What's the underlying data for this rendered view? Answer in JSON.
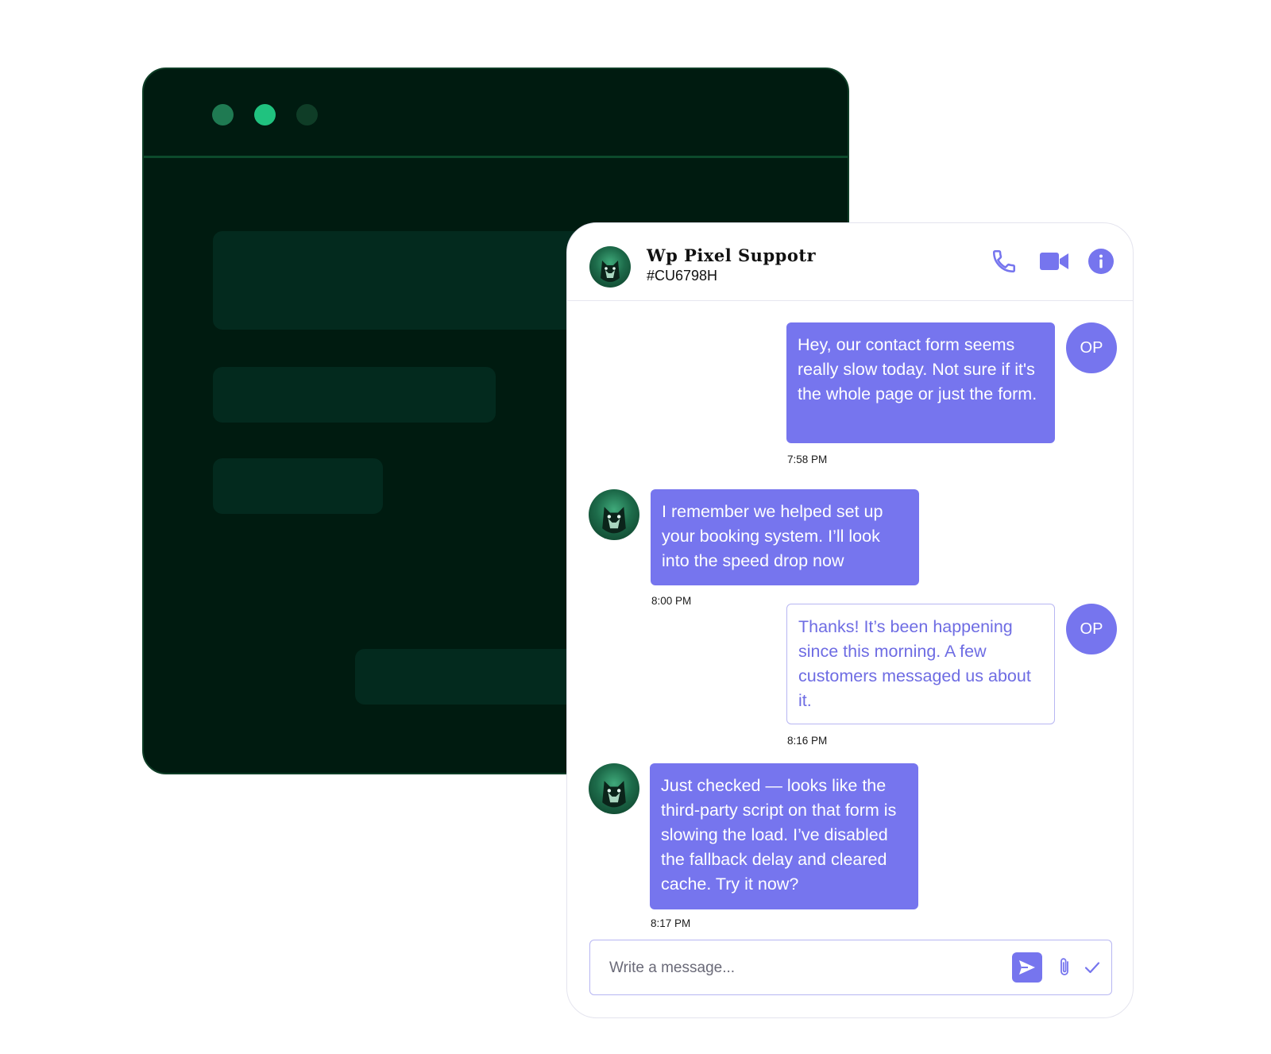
{
  "header": {
    "agent_name": "Wp Pixel Suppotr",
    "ticket_id": "#CU6798H",
    "icons": [
      "phone-icon",
      "video-icon",
      "info-icon"
    ]
  },
  "messages": [
    {
      "sender": "customer",
      "avatar_label": "OP",
      "text": "Hey, our contact form seems really slow today. Not sure if it's the whole page or just the form.",
      "time": "7:58 PM",
      "style": "filled"
    },
    {
      "sender": "agent",
      "text": "I remember we helped set up your booking system. I’ll look into the speed drop now",
      "time": "8:00 PM",
      "style": "filled"
    },
    {
      "sender": "customer",
      "avatar_label": "OP",
      "text": "Thanks! It’s been happening since this morning. A few customers messaged us about it.",
      "time": "8:16 PM",
      "style": "outline"
    },
    {
      "sender": "agent",
      "text": "Just checked — looks like the third-party script on that form is slowing the load. I’ve disabled the fallback delay and cleared cache. Try it now?",
      "time": "8:17 PM",
      "style": "filled"
    }
  ],
  "composer": {
    "placeholder": "Write a message..."
  },
  "colors": {
    "accent": "#7675ee",
    "window_bg": "#001b10",
    "window_dots": [
      "#1f7a52",
      "#20c27f",
      "#0f3d27"
    ]
  }
}
